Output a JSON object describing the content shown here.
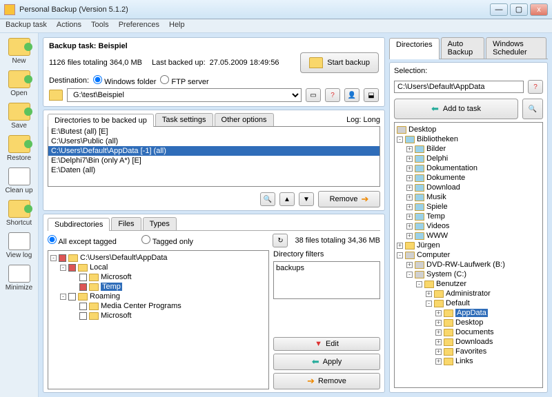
{
  "window": {
    "title": "Personal Backup (Version 5.1.2)"
  },
  "menu": [
    "Backup task",
    "Actions",
    "Tools",
    "Preferences",
    "Help"
  ],
  "sidebar": [
    {
      "label": "New"
    },
    {
      "label": "Open"
    },
    {
      "label": "Save"
    },
    {
      "label": "Restore"
    },
    {
      "label": "Clean up"
    },
    {
      "label": "Shortcut"
    },
    {
      "label": "View log"
    },
    {
      "label": "Minimize"
    }
  ],
  "task": {
    "heading": "Backup task: Beispiel",
    "stats": "1126 files totaling 364,0 MB",
    "lastlabel": "Last backed up:",
    "lastval": "27.05.2009 18:49:56",
    "destlabel": "Destination:",
    "opt_win": "Windows folder",
    "opt_ftp": "FTP server",
    "startbtn": "Start backup",
    "path": "G:\\test\\Beispiel"
  },
  "dir_tabs": [
    "Directories to be backed up",
    "Task settings",
    "Other options"
  ],
  "loglabel": "Log: Long",
  "dirs": [
    "E:\\Butest (all) [E]",
    "C:\\Users\\Public (all)",
    "C:\\Users\\Default\\AppData [-1] (all)",
    "E:\\Delphi7\\Bin (only A*) [E]",
    "E:\\Daten (all)"
  ],
  "removebtn": "Remove",
  "sub_tabs": [
    "Subdirectories",
    "Files",
    "Types"
  ],
  "radio_all": "All except tagged",
  "radio_tag": "Tagged only",
  "substats": "38 files totaling 34,36 MB",
  "subroot": "C:\\Users\\Default\\AppData",
  "subtree": {
    "local": "Local",
    "ms1": "Microsoft",
    "temp": "Temp",
    "roaming": "Roaming",
    "mcp": "Media Center Programs",
    "ms2": "Microsoft"
  },
  "dfilter_label": "Directory filters",
  "dfilter_val": "backups",
  "actions": {
    "edit": "Edit",
    "apply": "Apply",
    "remove": "Remove"
  },
  "right_tabs": [
    "Directories",
    "Auto Backup",
    "Windows Scheduler"
  ],
  "sel_label": "Selection:",
  "sel_path": "C:\\Users\\Default\\AppData",
  "addbtn": "Add to task",
  "rtree": {
    "desktop": "Desktop",
    "bib": "Bibliotheken",
    "items1": [
      "Bilder",
      "Delphi",
      "Dokumentation",
      "Dokumente",
      "Download",
      "Musik",
      "Spiele",
      "Temp",
      "Videos",
      "WWW"
    ],
    "jurgen": "Jürgen",
    "computer": "Computer",
    "dvd": "DVD-RW-Laufwerk (B:)",
    "sysc": "System (C:)",
    "benutzer": "Benutzer",
    "admin": "Administrator",
    "default": "Default",
    "items2": [
      "AppData",
      "Desktop",
      "Documents",
      "Downloads",
      "Favorites",
      "Links"
    ]
  }
}
